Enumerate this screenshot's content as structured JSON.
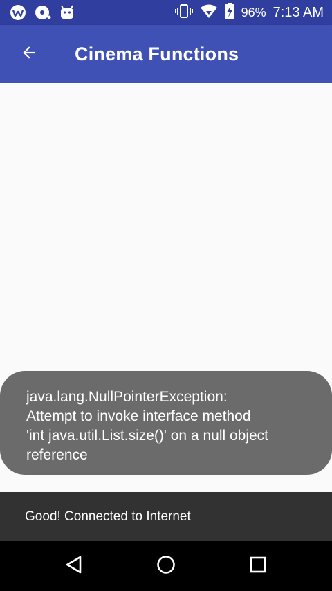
{
  "status_bar": {
    "notification_icons": [
      "wifi-assistant-icon",
      "record-icon",
      "android-icon"
    ],
    "status_icons": [
      "vibrate-icon",
      "wifi-icon",
      "battery-charging-icon"
    ],
    "battery": "96%",
    "time": "7:13 AM",
    "background_color": "#303f9f"
  },
  "app_bar": {
    "title": "Cinema Functions",
    "back_icon": "arrow-back-icon",
    "background_color": "#3f51b5"
  },
  "toast": {
    "lines": [
      "java.lang.NullPointerException:",
      "Attempt to invoke interface method",
      "'int java.util.List.size()' on a null object",
      "reference"
    ]
  },
  "snackbar": {
    "message": "Good! Connected to Internet"
  },
  "nav_bar": {
    "buttons": [
      "back-triangle-icon",
      "home-circle-icon",
      "recents-square-icon"
    ]
  }
}
